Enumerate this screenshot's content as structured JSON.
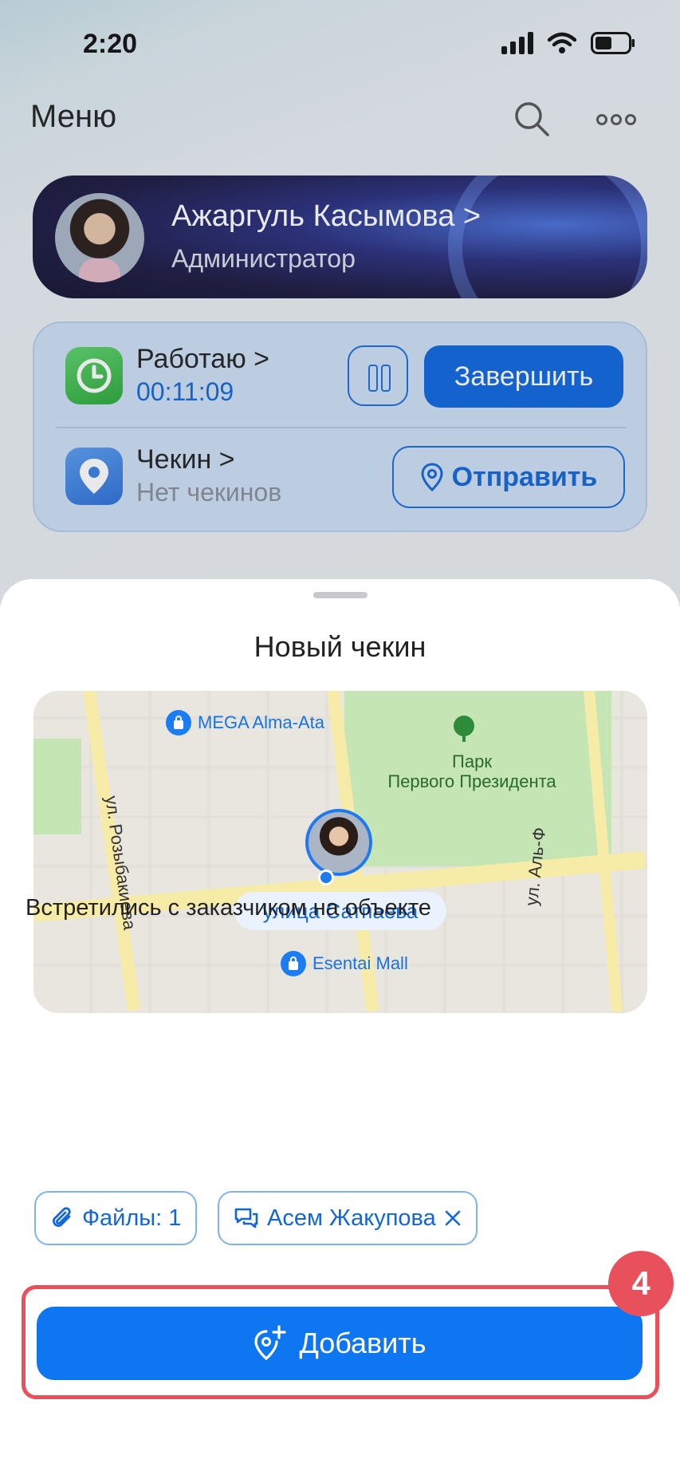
{
  "status_bar": {
    "time": "2:20"
  },
  "header": {
    "title": "Меню",
    "search_icon": "search-icon",
    "more_icon": "more-dots-icon"
  },
  "profile": {
    "name": "Ажаргуль Касымова",
    "chevron": ">",
    "role": "Администратор"
  },
  "work": {
    "label": "Работаю",
    "chevron": ">",
    "timer": "00:11:09",
    "finish_label": "Завершить"
  },
  "checkin": {
    "label": "Чекин",
    "chevron": ">",
    "status": "Нет чекинов",
    "send_label": "Отправить"
  },
  "sheet": {
    "title": "Новый чекин",
    "map": {
      "poi_top": "MEGA Alma-Ata",
      "park_line1": "Парк",
      "park_line2": "Первого Президента",
      "street_left": "ул. Розыбакиева",
      "street_right": "ул. Аль-Фараби",
      "street_right_visible": "ул. Аль-Ф",
      "poi_bottom": "Esentai Mall",
      "address": "улица Сатпаева"
    },
    "comment": "Встретились с заказчиком на объекте",
    "files_chip": "Файлы: 1",
    "person_chip": "Асем Жакупова",
    "add_label": "Добавить",
    "step_badge": "4"
  },
  "colors": {
    "accent": "#0f76f2",
    "highlight": "#e8505b",
    "park": "#a7d88e"
  }
}
